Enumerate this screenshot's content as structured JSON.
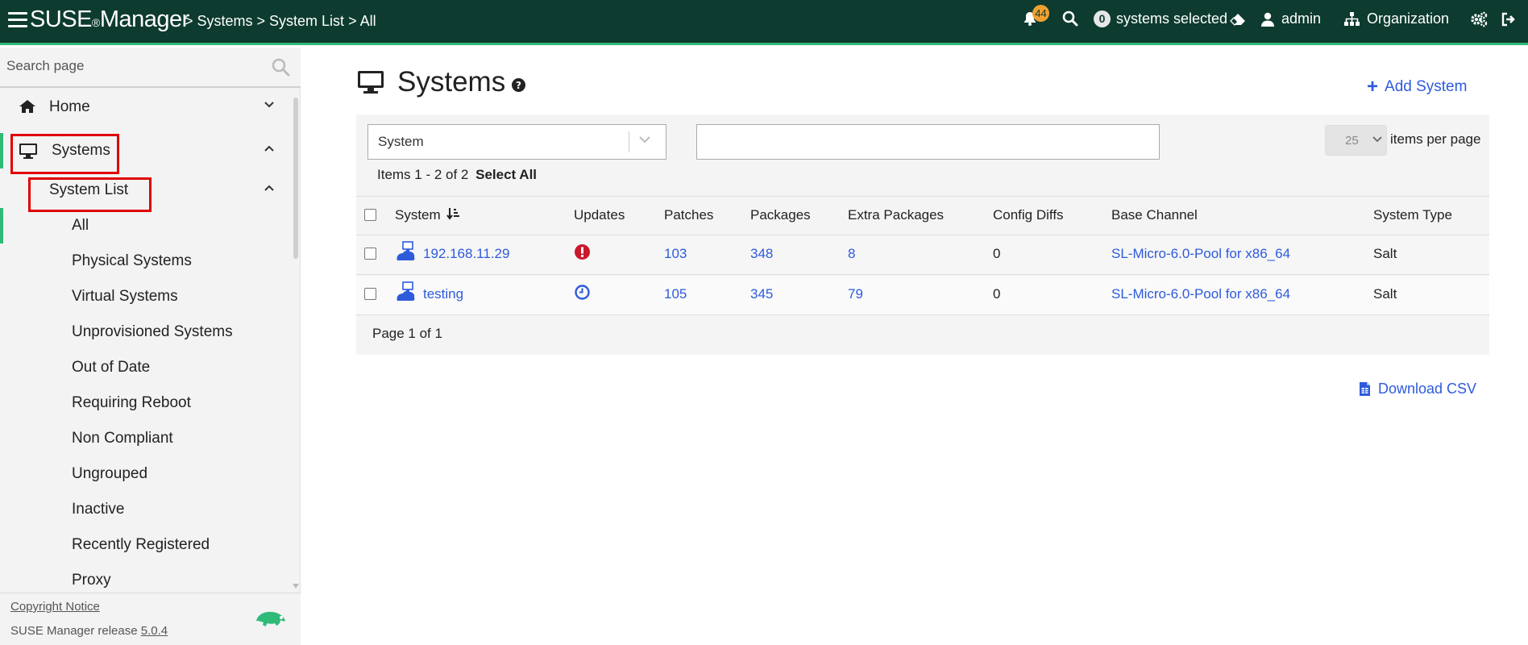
{
  "header": {
    "brand": "SUSE",
    "brand_reg": "®",
    "brand_product": "Manager",
    "breadcrumb": "> Systems > System List > All",
    "notifications_count": "44",
    "systems_selected_count": "0",
    "systems_selected_label": "systems selected",
    "user": "admin",
    "organization": "Organization"
  },
  "sidebar": {
    "search_placeholder": "Search page",
    "home": "Home",
    "systems": "Systems",
    "system_list": "System List",
    "sub_items": [
      "All",
      "Physical Systems",
      "Virtual Systems",
      "Unprovisioned Systems",
      "Out of Date",
      "Requiring Reboot",
      "Non Compliant",
      "Ungrouped",
      "Inactive",
      "Recently Registered",
      "Proxy"
    ],
    "copyright": "Copyright Notice",
    "release_prefix": "SUSE Manager release",
    "release_version": "5.0.4"
  },
  "main": {
    "title": "Systems",
    "add_system": "Add System",
    "filter_field": "System",
    "filter_value": "",
    "items_per_page": "25",
    "items_per_page_label": "items per page",
    "items_count": "Items 1 - 2 of 2",
    "select_all": "Select All",
    "columns": [
      "System",
      "Updates",
      "Patches",
      "Packages",
      "Extra Packages",
      "Config Diffs",
      "Base Channel",
      "System Type"
    ],
    "rows": [
      {
        "system": "192.168.11.29",
        "update_icon": "critical-alert-icon",
        "patches": "103",
        "packages": "348",
        "extra_packages": "8",
        "config_diffs": "0",
        "base_channel": "SL-Micro-6.0-Pool for x86_64",
        "system_type": "Salt"
      },
      {
        "system": "testing",
        "update_icon": "pending-clock-icon",
        "patches": "105",
        "packages": "345",
        "extra_packages": "79",
        "config_diffs": "0",
        "base_channel": "SL-Micro-6.0-Pool for x86_64",
        "system_type": "Salt"
      }
    ],
    "pager": "Page 1 of 1",
    "download_csv": "Download CSV"
  },
  "colors": {
    "header_bg": "#0d3b2f",
    "accent_green": "#30ba78",
    "link_blue": "#2e5bdc",
    "badge_orange": "#f0a030",
    "highlight_red": "#e00000"
  }
}
